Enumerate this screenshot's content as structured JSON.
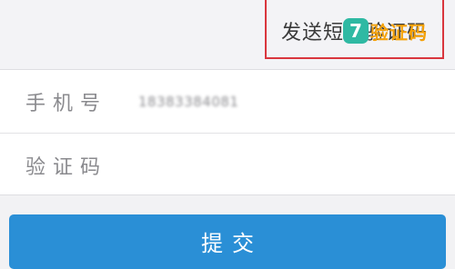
{
  "send_code": {
    "label": "发送短信验证码"
  },
  "watermark": {
    "badge": "7",
    "text": "验证码"
  },
  "form": {
    "phone_label": "手机号",
    "phone_value": "18383384081",
    "code_label": "验证码",
    "code_value": ""
  },
  "submit": {
    "label": "提交"
  },
  "colors": {
    "accent": "#2a8fd6",
    "highlight_border": "#d9363e",
    "watermark_badge": "#2fb9a3",
    "watermark_text": "#f5a20a"
  }
}
